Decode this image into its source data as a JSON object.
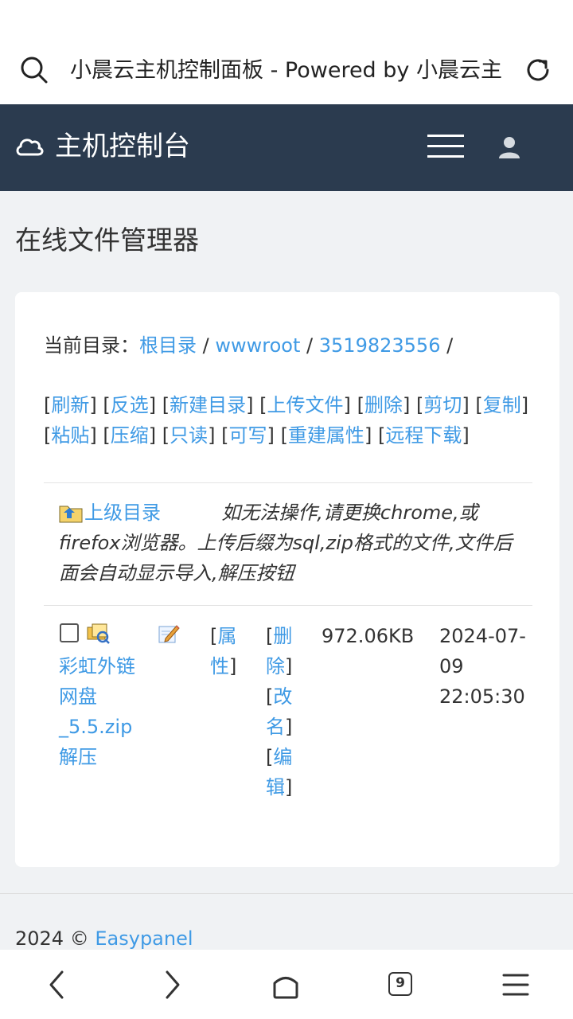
{
  "browser": {
    "page_title": "小晨云主机控制面板 - Powered by 小晨云主",
    "tab_count": "9"
  },
  "header": {
    "brand": "主机控制台"
  },
  "page": {
    "title": "在线文件管理器"
  },
  "breadcrumb": {
    "label": "当前目录：",
    "items": [
      "根目录",
      "wwwroot",
      "3519823556"
    ],
    "separator": "/"
  },
  "actions": [
    "刷新",
    "反选",
    "新建目录",
    "上传文件",
    "删除",
    "剪切",
    "复制",
    "粘贴",
    "压缩",
    "只读",
    "可写",
    "重建属性",
    "远程下载"
  ],
  "notice": {
    "parent_dir": "上级目录",
    "hint": "如无法操作,请更换chrome,或firefox浏览器。上传后缀为sql,zip格式的文件,文件后面会自动显示导入,解压按钮"
  },
  "files": [
    {
      "name": "彩虹外链网盘_5.5.zip",
      "extract": "解压",
      "attr": "属性",
      "delete": "删除",
      "rename": "改名",
      "edit": "编辑",
      "size": "972.06KB",
      "time": "2024-07-09 22:05:30"
    }
  ],
  "footer": {
    "copyright": "2024 ©",
    "link": "Easypanel"
  },
  "icons": {
    "search": "search-icon",
    "reload": "reload-icon",
    "cloud": "cloud-icon",
    "menu": "hamburger-menu-icon",
    "user": "user-icon"
  },
  "colors": {
    "header_bg": "#2b3b4f",
    "link": "#3f9ae5",
    "page_bg": "#f0f2f4"
  }
}
